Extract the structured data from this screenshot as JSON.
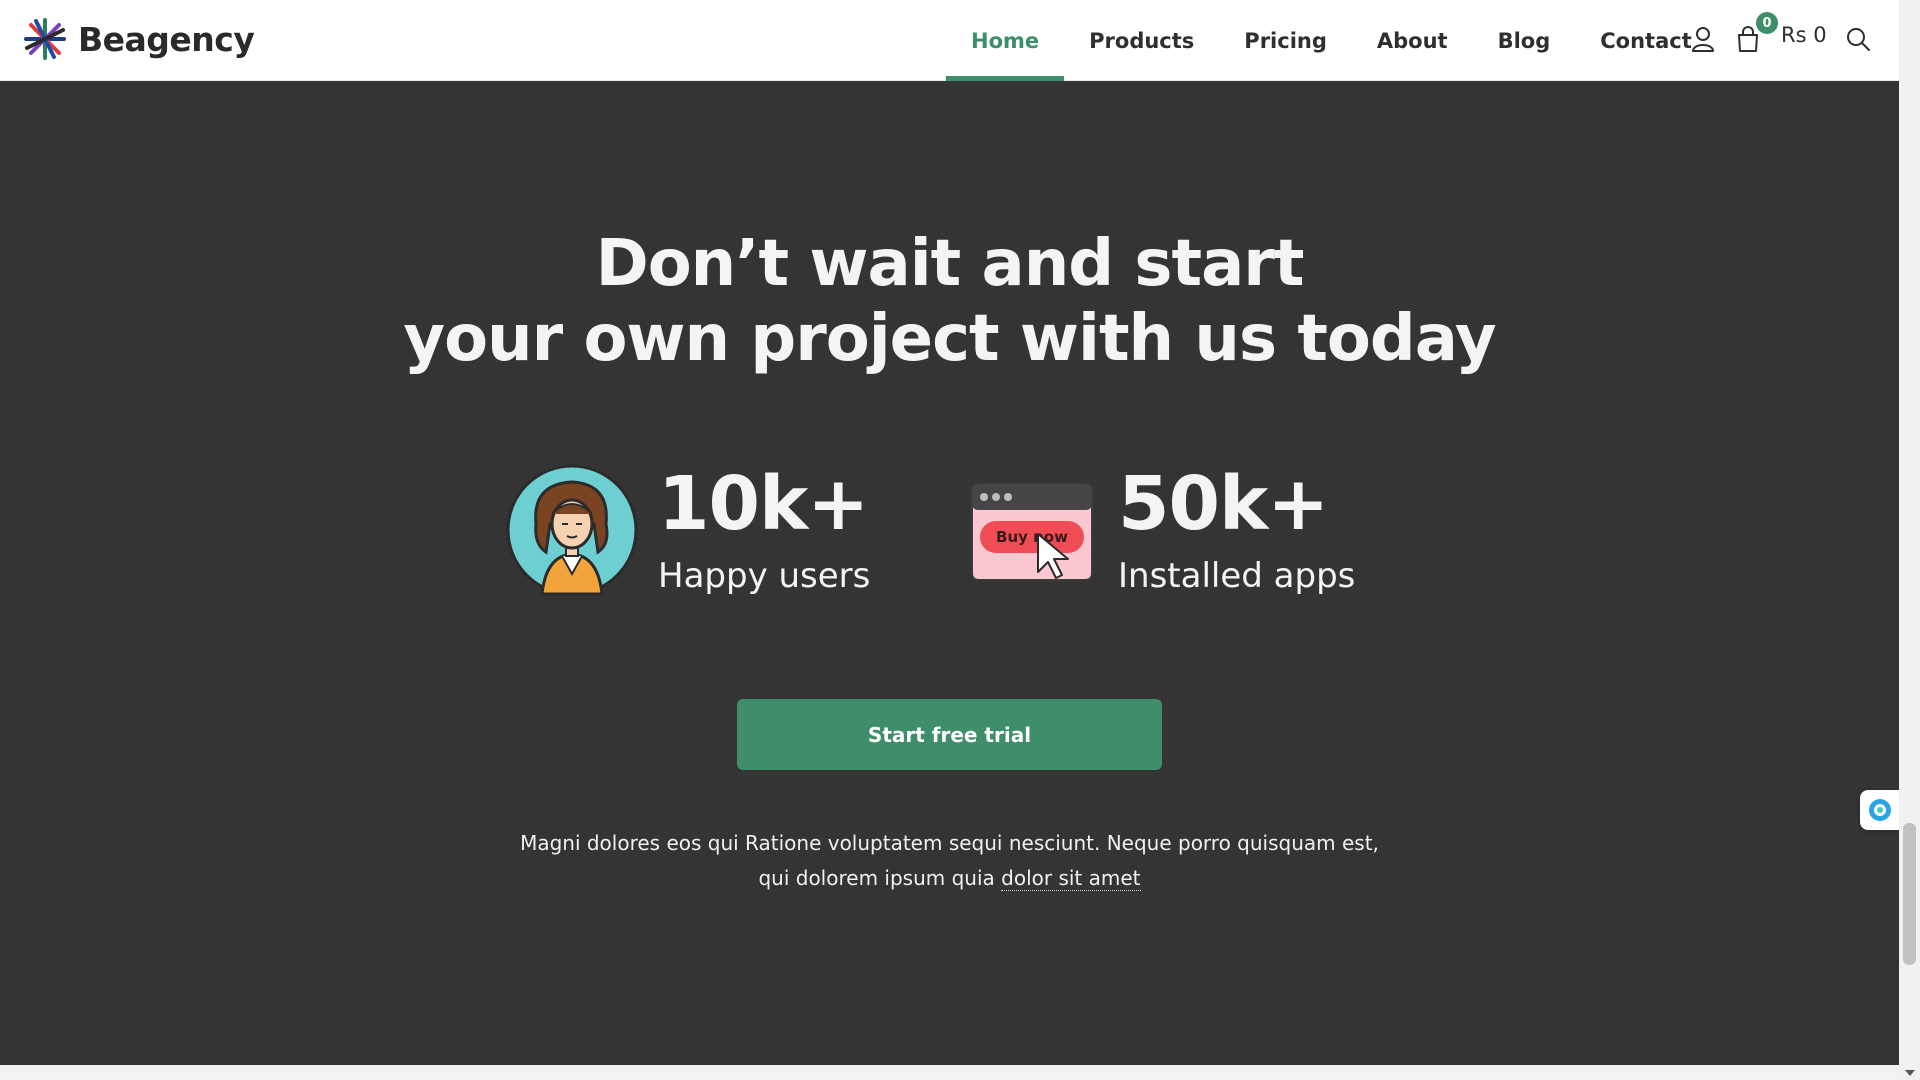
{
  "brand": {
    "name": "Beagency",
    "accent": "#3e8f69"
  },
  "nav": {
    "items": [
      {
        "label": "Home",
        "active": true
      },
      {
        "label": "Products",
        "active": false
      },
      {
        "label": "Pricing",
        "active": false
      },
      {
        "label": "About",
        "active": false
      },
      {
        "label": "Blog",
        "active": false
      },
      {
        "label": "Contact",
        "active": false
      }
    ]
  },
  "header_actions": {
    "account_icon": "user-icon",
    "cart_icon": "bag-icon",
    "cart_count": "0",
    "cart_total": "Rs 0",
    "search_icon": "search-icon"
  },
  "hero": {
    "line1": "Don’t wait and start",
    "line2": "your own project with us today"
  },
  "stats": [
    {
      "number": "10k+",
      "label": "Happy users",
      "icon": "user-avatar-illustration"
    },
    {
      "number": "50k+",
      "label": "Installed apps",
      "icon": "buy-now-browser-illustration",
      "icon_button_text": "Buy now"
    }
  ],
  "cta": {
    "label": "Start free trial"
  },
  "description": {
    "line1": "Magni dolores eos qui Ratione voluptatem sequi nesciunt. Neque porro quisquam est,",
    "line2_prefix": "qui dolorem ipsum quia ",
    "link": "dolor sit amet"
  },
  "colors": {
    "section_bg": "#343434",
    "text_light": "#f4f4f4",
    "cta_bg": "#3e8f69"
  }
}
